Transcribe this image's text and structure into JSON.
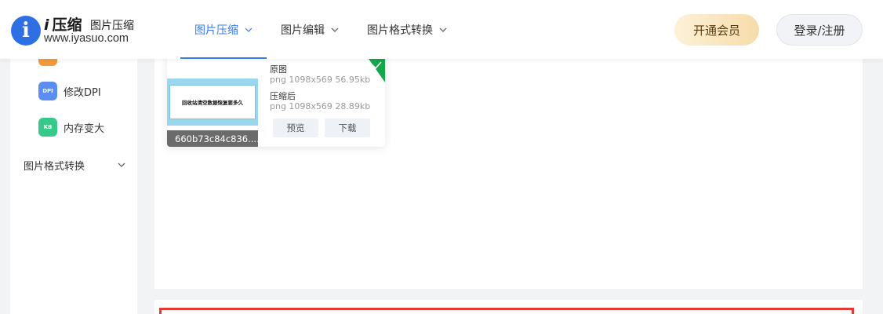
{
  "header": {
    "logo": {
      "letter": "i",
      "name_prefix": "i",
      "name": "压缩",
      "subtitle": "图片压缩",
      "url": "www.iyasuo.com"
    },
    "nav": [
      {
        "label": "图片压缩",
        "active": true
      },
      {
        "label": "图片编辑",
        "active": false
      },
      {
        "label": "图片格式转换",
        "active": false
      }
    ],
    "vip_label": "开通会员",
    "login_label": "登录/注册"
  },
  "sidebar": {
    "items": [
      {
        "label": "修改DPI",
        "icon": "dpi-icon",
        "icon_text": "DPI",
        "color": "#5b8ef0"
      },
      {
        "label": "内存变大",
        "icon": "kb-icon",
        "icon_text": "KB",
        "color": "#36c98a"
      }
    ],
    "group_label": "图片格式转换"
  },
  "card": {
    "thumb_text": "回收站清空数据恢复要多久",
    "filename": "660b73c84c836....",
    "original_label": "原图",
    "original_meta": "png  1098x569  56.95kb",
    "compressed_label": "压缩后",
    "compressed_meta": "png  1098x569  28.89kb",
    "preview_label": "预览",
    "download_label": "下载"
  },
  "colors": {
    "accent": "#3a7bf0",
    "success": "#12a84b",
    "alert": "#e53935",
    "vip_from": "#fdf1d8",
    "vip_to": "#f6dcaa"
  }
}
